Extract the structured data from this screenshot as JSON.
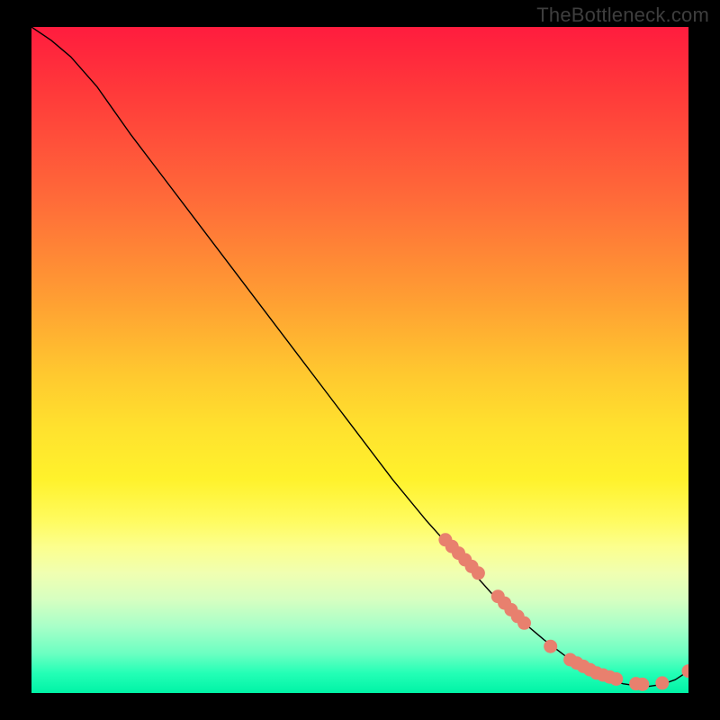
{
  "watermark": "TheBottleneck.com",
  "chart_data": {
    "type": "line",
    "title": "",
    "xlabel": "",
    "ylabel": "",
    "xlim": [
      0,
      100
    ],
    "ylim": [
      0,
      100
    ],
    "grid": false,
    "series": [
      {
        "name": "curve",
        "x": [
          0,
          3,
          6,
          10,
          15,
          20,
          25,
          30,
          35,
          40,
          45,
          50,
          55,
          60,
          65,
          70,
          72,
          75,
          78,
          80,
          82,
          84,
          86,
          88,
          90,
          92,
          94,
          96,
          98,
          100
        ],
        "y": [
          100,
          98,
          95.5,
          91,
          84,
          77.5,
          71,
          64.5,
          58,
          51.5,
          45,
          38.5,
          32,
          26,
          20.5,
          15,
          13,
          10.5,
          8,
          6.5,
          5,
          3.8,
          2.8,
          2,
          1.4,
          1.1,
          1,
          1.3,
          2,
          3.3
        ]
      }
    ],
    "markers": {
      "name": "dots",
      "color": "#e8806e",
      "points": [
        {
          "x": 63,
          "y": 23
        },
        {
          "x": 64,
          "y": 22
        },
        {
          "x": 65,
          "y": 21
        },
        {
          "x": 66,
          "y": 20
        },
        {
          "x": 67,
          "y": 19
        },
        {
          "x": 68,
          "y": 18
        },
        {
          "x": 71,
          "y": 14.5
        },
        {
          "x": 72,
          "y": 13.5
        },
        {
          "x": 73,
          "y": 12.5
        },
        {
          "x": 74,
          "y": 11.5
        },
        {
          "x": 75,
          "y": 10.5
        },
        {
          "x": 79,
          "y": 7
        },
        {
          "x": 82,
          "y": 5
        },
        {
          "x": 83,
          "y": 4.5
        },
        {
          "x": 84,
          "y": 4
        },
        {
          "x": 85,
          "y": 3.5
        },
        {
          "x": 86,
          "y": 3
        },
        {
          "x": 87,
          "y": 2.7
        },
        {
          "x": 88,
          "y": 2.4
        },
        {
          "x": 89,
          "y": 2.1
        },
        {
          "x": 92,
          "y": 1.4
        },
        {
          "x": 93,
          "y": 1.3
        },
        {
          "x": 96,
          "y": 1.5
        },
        {
          "x": 100,
          "y": 3.3
        }
      ]
    }
  }
}
